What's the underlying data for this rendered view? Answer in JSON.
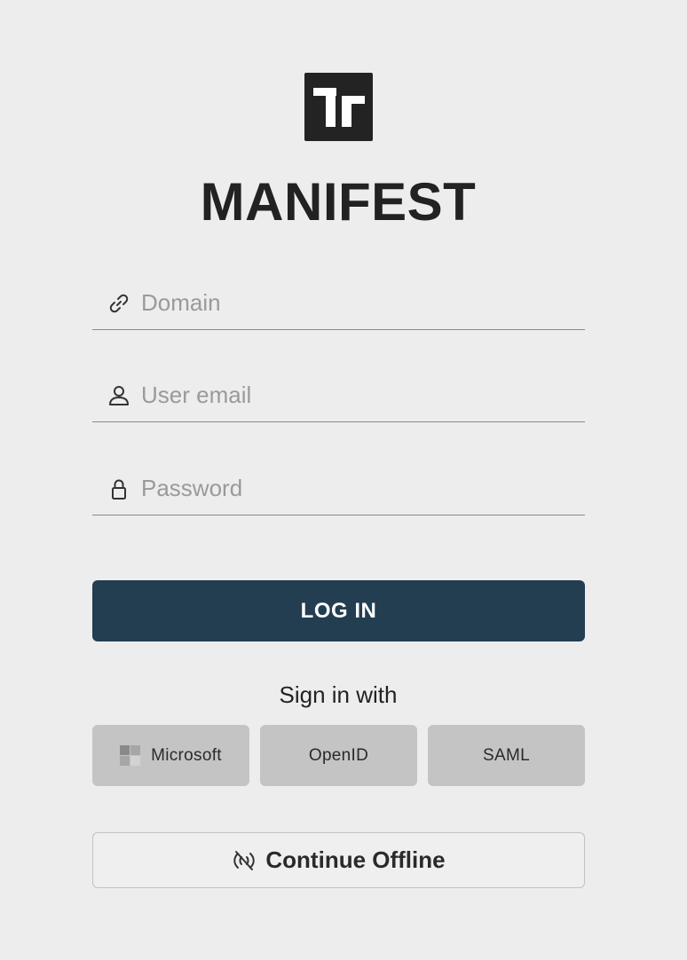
{
  "app": {
    "title": "MANIFEST",
    "logo_icon": "manifest-logo-icon"
  },
  "form": {
    "domain": {
      "placeholder": "Domain",
      "value": "",
      "icon": "link-icon"
    },
    "email": {
      "placeholder": "User email",
      "value": "",
      "icon": "user-icon"
    },
    "password": {
      "placeholder": "Password",
      "value": "",
      "icon": "lock-icon"
    }
  },
  "login_button": {
    "label": "LOG IN"
  },
  "sso": {
    "heading": "Sign in with",
    "providers": [
      {
        "label": "Microsoft",
        "icon": "microsoft-icon"
      },
      {
        "label": "OpenID"
      },
      {
        "label": "SAML"
      }
    ]
  },
  "offline_button": {
    "label": "Continue Offline",
    "icon": "offline-signal-icon"
  },
  "colors": {
    "background": "#ededed",
    "primary": "#233d51",
    "sso_button": "#c4c4c4",
    "text": "#222222",
    "placeholder": "#9a9a9a"
  }
}
